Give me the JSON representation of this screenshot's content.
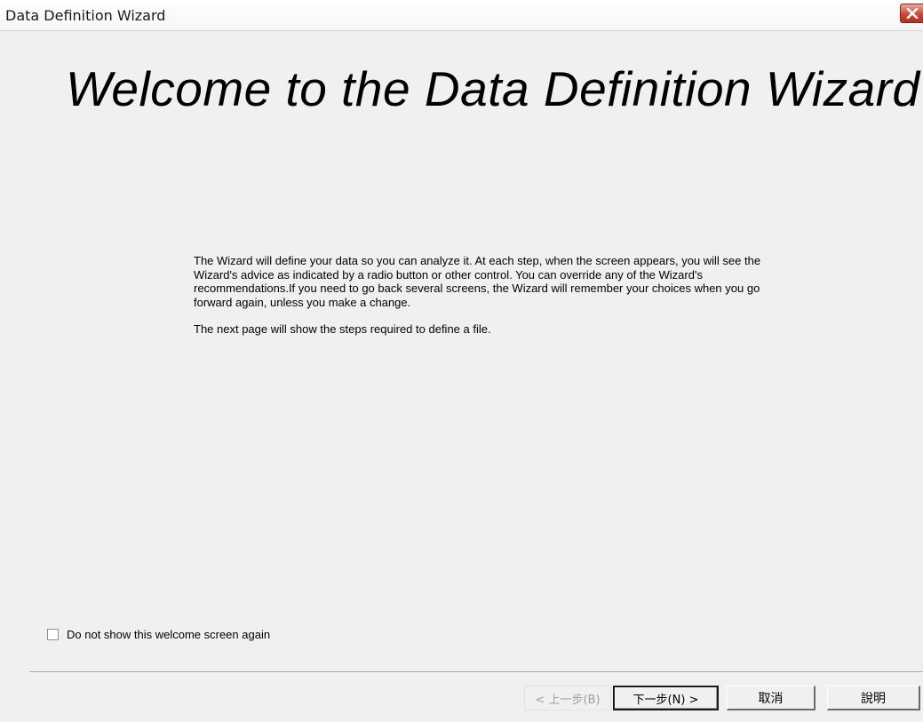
{
  "window": {
    "title": "Data Definition Wizard"
  },
  "main": {
    "heading": "Welcome to the Data Definition Wizard",
    "paragraph1": "The Wizard will define your data so you can analyze it. At each step, when the screen appears, you will see the Wizard's advice as indicated by a radio button or other control. You can override any of the Wizard's recommendations.If you need to go back several screens, the Wizard will remember your choices when you go forward again, unless you make a change.",
    "paragraph2": "The next page will show the steps required to define a file."
  },
  "options": {
    "dont_show_label": "Do not show this welcome screen again",
    "dont_show_checked": false
  },
  "buttons": {
    "back": "< 上一步(B)",
    "next": "下一步(N) >",
    "cancel": "取消",
    "help": "說明"
  },
  "icons": {
    "close": "close-icon",
    "checkbox": "checkbox-unchecked-icon"
  },
  "colors": {
    "close_button": "#c74a3a",
    "disabled_text": "#a0a0a0"
  }
}
